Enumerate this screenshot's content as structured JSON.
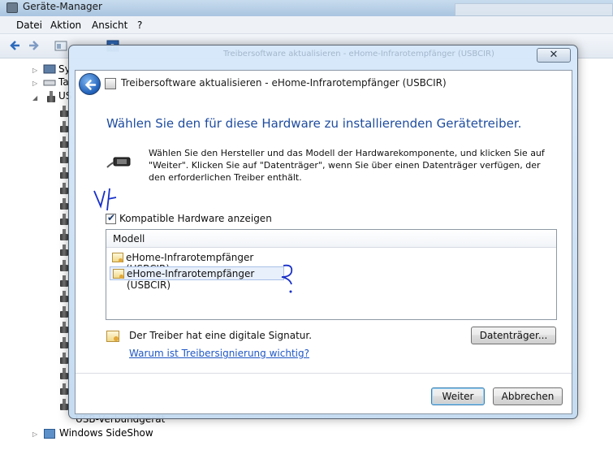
{
  "background_window": {
    "title": "Geräte-Manager",
    "menu": [
      "Datei",
      "Aktion",
      "Ansicht",
      "?"
    ],
    "tree": {
      "item_sy": "Sy",
      "item_ta": "Ta",
      "item_us": "US",
      "usb_verbundgeraet": "USB-Verbundgerät",
      "windows_sideshow": "Windows SideShow"
    }
  },
  "dialog": {
    "background_title": "Treibersoftware aktualisieren - eHome-Infrarotempfänger (USBCIR)",
    "close_glyph": "✕",
    "wizard_title": "Treibersoftware aktualisieren - eHome-Infrarotempfänger (USBCIR)",
    "heading": "Wählen Sie den für diese Hardware zu installierenden Gerätetreiber.",
    "description": "Wählen Sie den Hersteller und das Modell der Hardwarekomponente, und klicken Sie auf \"Weiter\". Klicken Sie auf \"Datenträger\", wenn Sie über einen Datenträger verfügen, der den erforderlichen Treiber enthält.",
    "compatible_checkbox": {
      "label": "Kompatible Hardware anzeigen",
      "checked": true
    },
    "model_list": {
      "header": "Modell",
      "items": [
        {
          "label": "eHome-Infrarotempfänger (USBCIR)",
          "selected": false
        },
        {
          "label": "eHome-Infrarotempfänger (USBCIR)",
          "selected": true
        }
      ]
    },
    "signature_text": "Der Treiber hat eine digitale Signatur.",
    "signature_link": "Warum ist Treibersignierung wichtig?",
    "buttons": {
      "datentraeger": "Datenträger...",
      "weiter": "Weiter",
      "abbrechen": "Abbrechen"
    }
  },
  "icons": {
    "back": "back-arrow-icon",
    "usb_plug": "usb-plug-icon",
    "certificate": "certificate-icon"
  },
  "colors": {
    "heading": "#1e4c9f",
    "link": "#1f57c5",
    "annotation_ink": "#1830c8",
    "dialog_frame": "#c8ddf2"
  }
}
